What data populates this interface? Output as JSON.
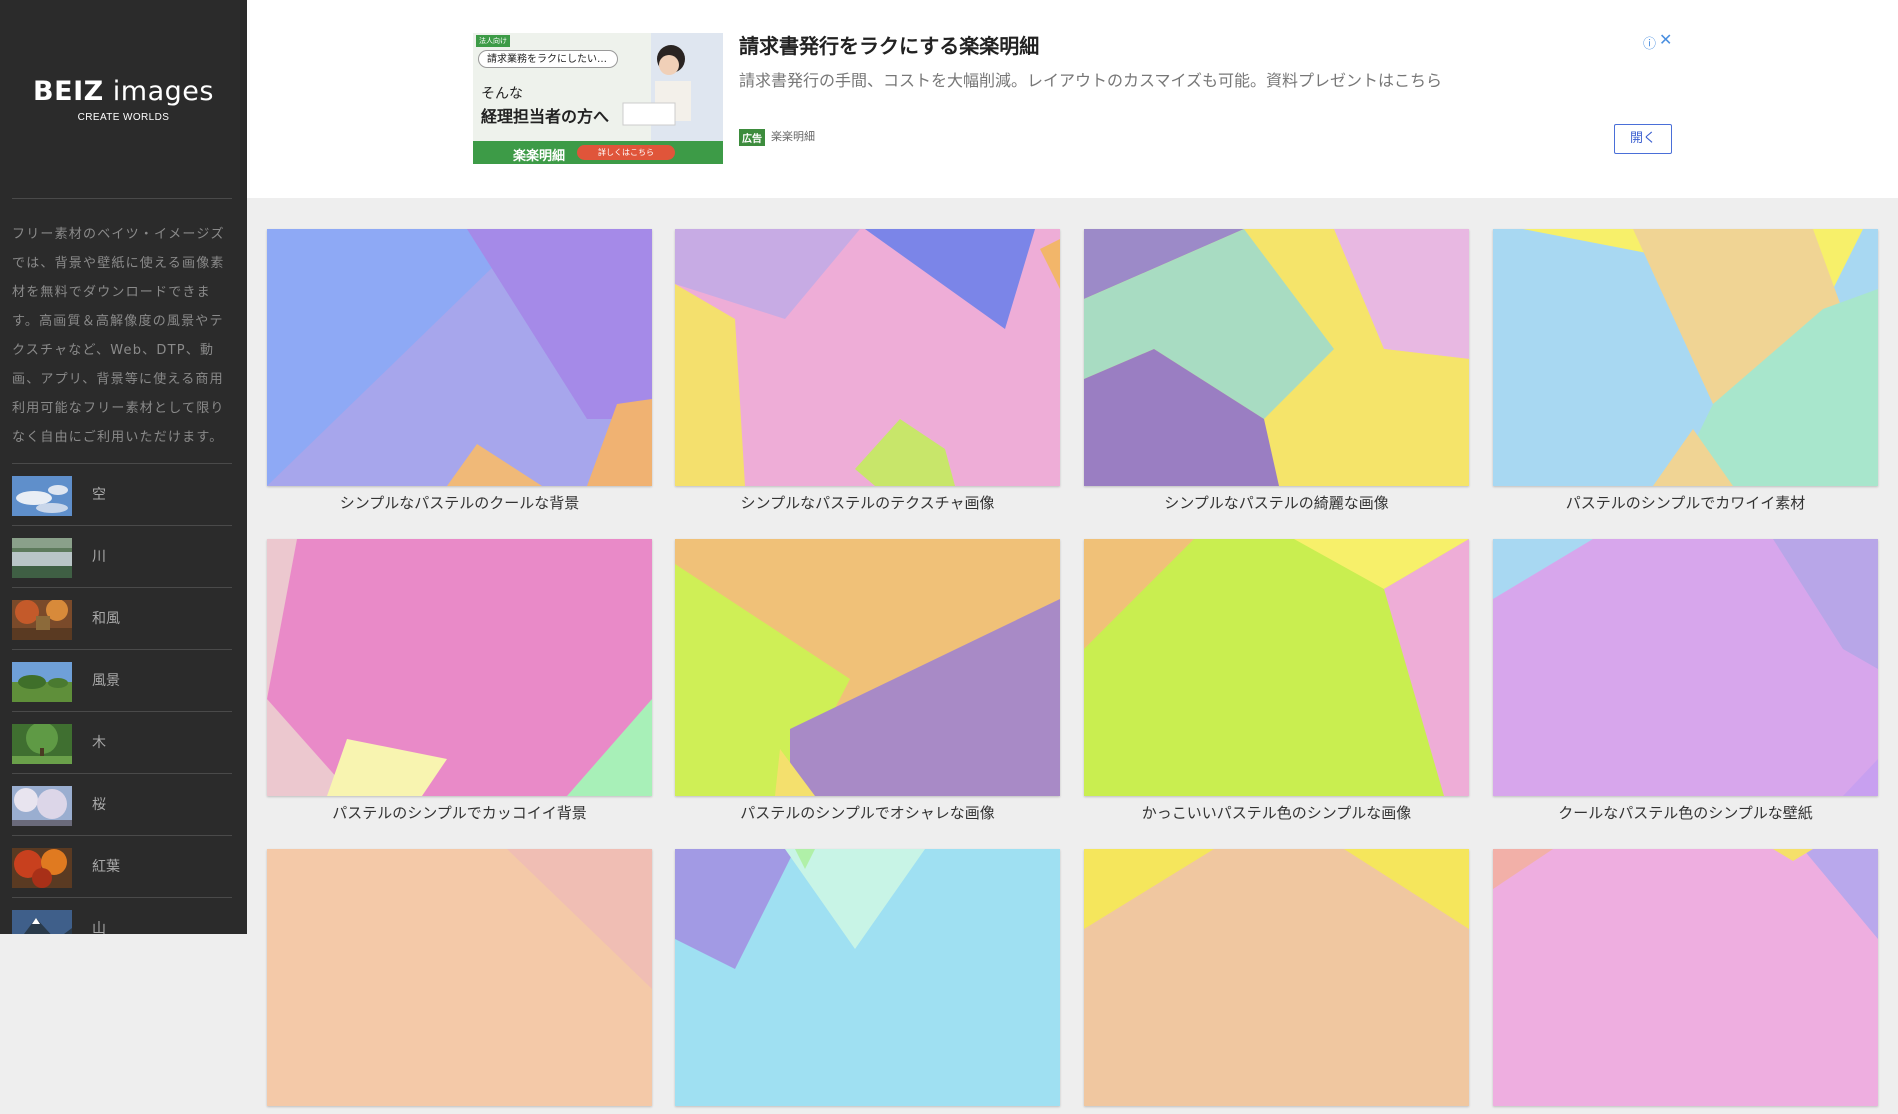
{
  "sidebar": {
    "logo": {
      "strong": "BEIZ",
      "rest": " images",
      "tagline": "CREATE WORLDS"
    },
    "description": "フリー素材のベイツ・イメージズでは、背景や壁紙に使える画像素材を無料でダウンロードできます。高画質＆高解像度の風景やテクスチャなど、Web、DTP、動画、アプリ、背景等に使える商用利用可能なフリー素材として限りなく自由にご利用いただけます。",
    "categories": [
      {
        "label": "空"
      },
      {
        "label": "川"
      },
      {
        "label": "和風"
      },
      {
        "label": "風景"
      },
      {
        "label": "木"
      },
      {
        "label": "桜"
      },
      {
        "label": "紅葉"
      },
      {
        "label": "山"
      }
    ]
  },
  "ad": {
    "banner": {
      "corner_tag": "法人向け",
      "bubble": "請求業務をラクにしたい…",
      "line1": "そんな",
      "line2": "経理担当者の方へ",
      "brand": "楽楽明細",
      "cta": "詳しくはこちら"
    },
    "title": "請求書発行をラクにする楽楽明細",
    "text": "請求書発行の手間、コストを大幅削減。レイアウトのカスマイズも可能。資料プレゼントはこちら",
    "badge": "広告",
    "sponsor": "楽楽明細",
    "open_label": "開く",
    "info_icon": "ⓘ",
    "close_icon": "✕"
  },
  "grid": {
    "items": [
      {
        "caption": "シンプルなパステルのクールな背景"
      },
      {
        "caption": "シンプルなパステルのテクスチャ画像"
      },
      {
        "caption": "シンプルなパステルの綺麗な画像"
      },
      {
        "caption": "パステルのシンプルでカワイイ素材"
      },
      {
        "caption": "パステルのシンプルでカッコイイ背景"
      },
      {
        "caption": "パステルのシンプルでオシャレな画像"
      },
      {
        "caption": "かっこいいパステル色のシンプルな画像"
      },
      {
        "caption": "クールなパステル色のシンプルな壁紙"
      },
      {
        "caption": ""
      },
      {
        "caption": ""
      },
      {
        "caption": ""
      },
      {
        "caption": ""
      }
    ]
  }
}
